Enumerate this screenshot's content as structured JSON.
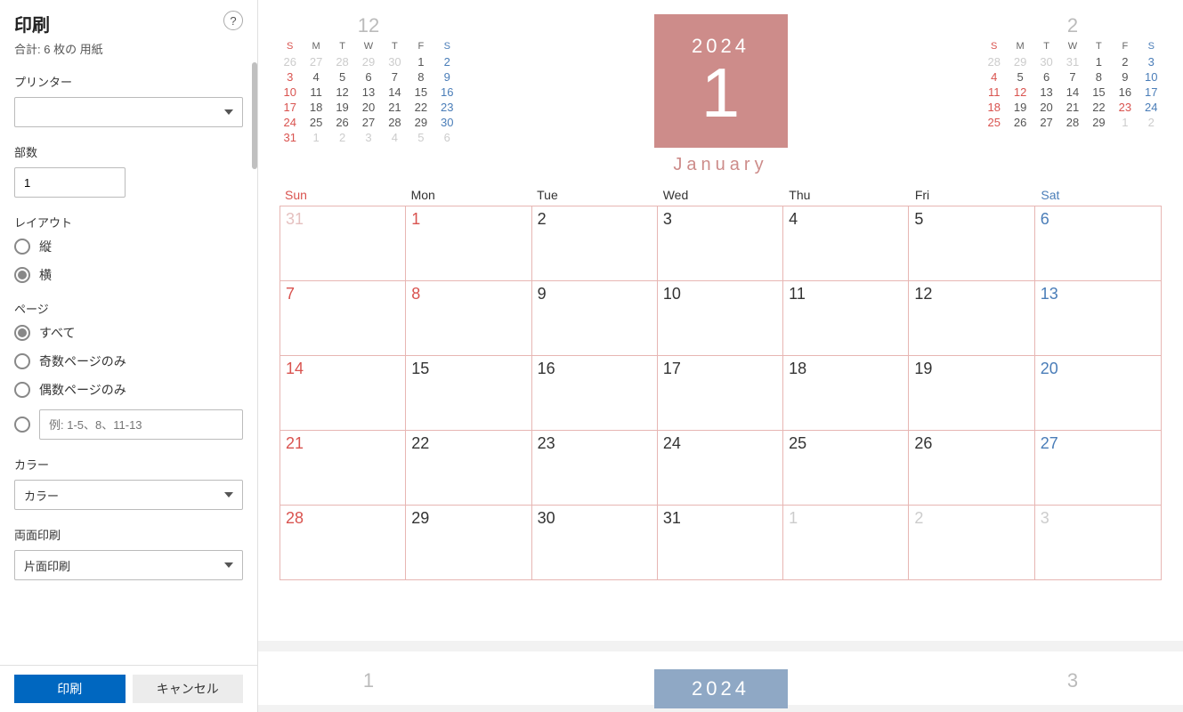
{
  "sidebar": {
    "title": "印刷",
    "subtitle": "合計: 6 枚の 用紙",
    "help_label": "?",
    "printer_label": "プリンター",
    "printer_value": "",
    "copies_label": "部数",
    "copies_value": "1",
    "layout_label": "レイアウト",
    "layout_portrait": "縦",
    "layout_landscape": "横",
    "pages_label": "ページ",
    "pages_all": "すべて",
    "pages_odd": "奇数ページのみ",
    "pages_even": "偶数ページのみ",
    "pages_custom_placeholder": "例: 1-5、8、11-13",
    "color_label": "カラー",
    "color_value": "カラー",
    "duplex_label": "両面印刷",
    "duplex_value": "片面印刷",
    "print_btn": "印刷",
    "cancel_btn": "キャンセル"
  },
  "calendar": {
    "year": "2024",
    "month_num": "1",
    "month_name": "January",
    "day_headers": [
      "Sun",
      "Mon",
      "Tue",
      "Wed",
      "Thu",
      "Fri",
      "Sat"
    ],
    "mini_headers": [
      "S",
      "M",
      "T",
      "W",
      "T",
      "F",
      "S"
    ],
    "prev": {
      "title": "12",
      "cells": [
        {
          "d": "26",
          "c": "off sun"
        },
        {
          "d": "27",
          "c": "off"
        },
        {
          "d": "28",
          "c": "off"
        },
        {
          "d": "29",
          "c": "off"
        },
        {
          "d": "30",
          "c": "off"
        },
        {
          "d": "1",
          "c": ""
        },
        {
          "d": "2",
          "c": "sat"
        },
        {
          "d": "3",
          "c": "sun"
        },
        {
          "d": "4",
          "c": ""
        },
        {
          "d": "5",
          "c": ""
        },
        {
          "d": "6",
          "c": ""
        },
        {
          "d": "7",
          "c": ""
        },
        {
          "d": "8",
          "c": ""
        },
        {
          "d": "9",
          "c": "sat"
        },
        {
          "d": "10",
          "c": "sun"
        },
        {
          "d": "11",
          "c": ""
        },
        {
          "d": "12",
          "c": ""
        },
        {
          "d": "13",
          "c": ""
        },
        {
          "d": "14",
          "c": ""
        },
        {
          "d": "15",
          "c": ""
        },
        {
          "d": "16",
          "c": "sat"
        },
        {
          "d": "17",
          "c": "sun"
        },
        {
          "d": "18",
          "c": ""
        },
        {
          "d": "19",
          "c": ""
        },
        {
          "d": "20",
          "c": ""
        },
        {
          "d": "21",
          "c": ""
        },
        {
          "d": "22",
          "c": ""
        },
        {
          "d": "23",
          "c": "sat"
        },
        {
          "d": "24",
          "c": "sun"
        },
        {
          "d": "25",
          "c": ""
        },
        {
          "d": "26",
          "c": ""
        },
        {
          "d": "27",
          "c": ""
        },
        {
          "d": "28",
          "c": ""
        },
        {
          "d": "29",
          "c": ""
        },
        {
          "d": "30",
          "c": "sat"
        },
        {
          "d": "31",
          "c": "sun"
        },
        {
          "d": "1",
          "c": "off"
        },
        {
          "d": "2",
          "c": "off"
        },
        {
          "d": "3",
          "c": "off"
        },
        {
          "d": "4",
          "c": "off"
        },
        {
          "d": "5",
          "c": "off"
        },
        {
          "d": "6",
          "c": "off"
        }
      ]
    },
    "next": {
      "title": "2",
      "cells": [
        {
          "d": "28",
          "c": "off sun"
        },
        {
          "d": "29",
          "c": "off"
        },
        {
          "d": "30",
          "c": "off"
        },
        {
          "d": "31",
          "c": "off"
        },
        {
          "d": "1",
          "c": ""
        },
        {
          "d": "2",
          "c": ""
        },
        {
          "d": "3",
          "c": "sat"
        },
        {
          "d": "4",
          "c": "sun"
        },
        {
          "d": "5",
          "c": ""
        },
        {
          "d": "6",
          "c": ""
        },
        {
          "d": "7",
          "c": ""
        },
        {
          "d": "8",
          "c": ""
        },
        {
          "d": "9",
          "c": ""
        },
        {
          "d": "10",
          "c": "sat"
        },
        {
          "d": "11",
          "c": "sun"
        },
        {
          "d": "12",
          "c": "sun"
        },
        {
          "d": "13",
          "c": ""
        },
        {
          "d": "14",
          "c": ""
        },
        {
          "d": "15",
          "c": ""
        },
        {
          "d": "16",
          "c": ""
        },
        {
          "d": "17",
          "c": "sat"
        },
        {
          "d": "18",
          "c": "sun"
        },
        {
          "d": "19",
          "c": ""
        },
        {
          "d": "20",
          "c": ""
        },
        {
          "d": "21",
          "c": ""
        },
        {
          "d": "22",
          "c": ""
        },
        {
          "d": "23",
          "c": "sun"
        },
        {
          "d": "24",
          "c": "sat"
        },
        {
          "d": "25",
          "c": "sun"
        },
        {
          "d": "26",
          "c": ""
        },
        {
          "d": "27",
          "c": ""
        },
        {
          "d": "28",
          "c": ""
        },
        {
          "d": "29",
          "c": ""
        },
        {
          "d": "1",
          "c": "off"
        },
        {
          "d": "2",
          "c": "off"
        }
      ]
    },
    "main": [
      {
        "d": "31",
        "c": "off sun"
      },
      {
        "d": "1",
        "c": "sun"
      },
      {
        "d": "2",
        "c": ""
      },
      {
        "d": "3",
        "c": ""
      },
      {
        "d": "4",
        "c": ""
      },
      {
        "d": "5",
        "c": ""
      },
      {
        "d": "6",
        "c": "sat"
      },
      {
        "d": "7",
        "c": "sun"
      },
      {
        "d": "8",
        "c": "sun"
      },
      {
        "d": "9",
        "c": ""
      },
      {
        "d": "10",
        "c": ""
      },
      {
        "d": "11",
        "c": ""
      },
      {
        "d": "12",
        "c": ""
      },
      {
        "d": "13",
        "c": "sat"
      },
      {
        "d": "14",
        "c": "sun"
      },
      {
        "d": "15",
        "c": ""
      },
      {
        "d": "16",
        "c": ""
      },
      {
        "d": "17",
        "c": ""
      },
      {
        "d": "18",
        "c": ""
      },
      {
        "d": "19",
        "c": ""
      },
      {
        "d": "20",
        "c": "sat"
      },
      {
        "d": "21",
        "c": "sun"
      },
      {
        "d": "22",
        "c": ""
      },
      {
        "d": "23",
        "c": ""
      },
      {
        "d": "24",
        "c": ""
      },
      {
        "d": "25",
        "c": ""
      },
      {
        "d": "26",
        "c": ""
      },
      {
        "d": "27",
        "c": "sat"
      },
      {
        "d": "28",
        "c": "sun"
      },
      {
        "d": "29",
        "c": ""
      },
      {
        "d": "30",
        "c": ""
      },
      {
        "d": "31",
        "c": ""
      },
      {
        "d": "1",
        "c": "off"
      },
      {
        "d": "2",
        "c": "off"
      },
      {
        "d": "3",
        "c": "off"
      }
    ],
    "page2": {
      "prev_title": "1",
      "year": "2024",
      "next_title": "3"
    }
  }
}
